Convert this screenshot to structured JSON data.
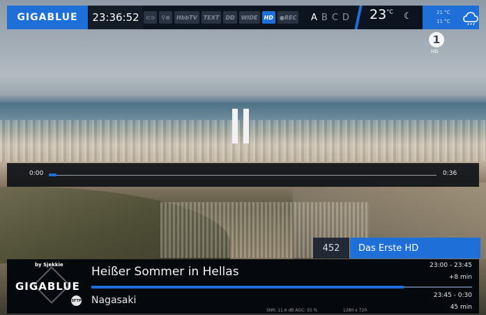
{
  "topbar": {
    "logo": "GIGABLUE",
    "clock": "23:36:52",
    "indicators": [
      {
        "label": "⊂⊃",
        "active": false
      },
      {
        "label": "⚲≡",
        "active": false
      },
      {
        "label": "HbbTV",
        "active": false
      },
      {
        "label": "TEXT",
        "active": false
      },
      {
        "label": "DD",
        "active": false
      },
      {
        "label": "WIDE",
        "active": false
      },
      {
        "label": "HD",
        "active": true
      },
      {
        "label": "●REC",
        "active": false
      }
    ],
    "slots": [
      "A",
      "B",
      "C",
      "D"
    ],
    "temperature": "23",
    "temp_unit": "°C",
    "temp_high": "21 °C",
    "temp_low": "11 °C"
  },
  "channel_logo": {
    "mark": "1",
    "label": "HD"
  },
  "playback": {
    "state": "paused",
    "elapsed": "0:00",
    "duration": "0:36",
    "progress": 0.02
  },
  "channel": {
    "number": "452",
    "name": "Das Erste HD"
  },
  "infobar": {
    "byline": "by Sjekkie",
    "logo": "GIGABLUE",
    "badge": "SFTP",
    "now": {
      "title": "Heißer Sommer in Hellas",
      "time": "23:00  -  23:45",
      "remaining": "+8 min",
      "progress": 0.82
    },
    "next": {
      "title": "Nagasaki",
      "time": "23:45  -   0:30",
      "duration": "45 min"
    },
    "signal": "SNR: 11.6 dB  AGC: 55 %",
    "resolution": "1280 x 720"
  },
  "colors": {
    "accent": "#1f6fd8",
    "bar_bg": "#0c1420"
  }
}
